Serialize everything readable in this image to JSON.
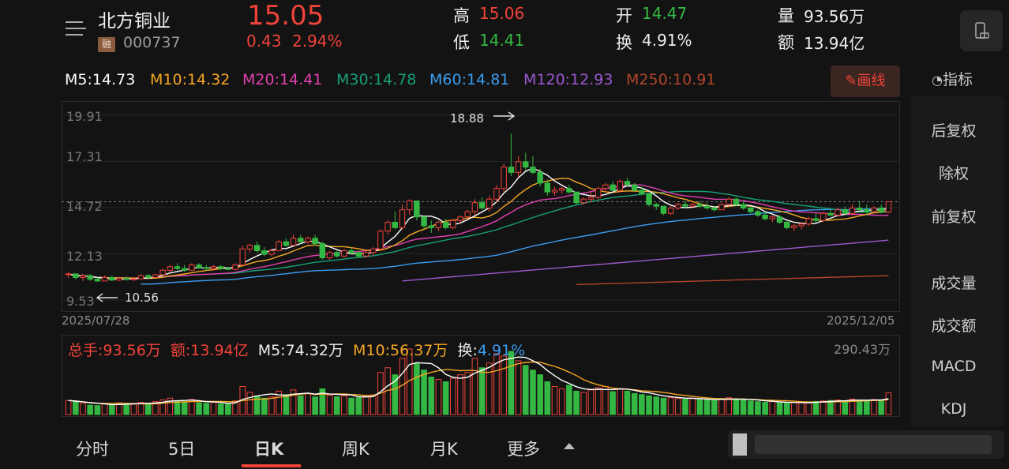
{
  "header": {
    "stock_name": "北方铜业",
    "margin_badge": "融",
    "stock_code": "000737",
    "last_price": "15.05",
    "change": "0.43",
    "change_pct": "2.94%",
    "high_label": "高",
    "high": "15.06",
    "low_label": "低",
    "low": "14.41",
    "open_label": "开",
    "open": "14.47",
    "turnover_label": "换",
    "turnover": "4.91%",
    "volume_label": "量",
    "volume": "93.56万",
    "amount_label": "额",
    "amount": "13.94亿"
  },
  "ma_legend": [
    {
      "label": "M5:14.73",
      "color": "#ffffff"
    },
    {
      "label": "M10:14.32",
      "color": "#f5a623"
    },
    {
      "label": "M20:14.41",
      "color": "#e040b0"
    },
    {
      "label": "M30:14.78",
      "color": "#17a07a"
    },
    {
      "label": "M60:14.81",
      "color": "#3b9df0"
    },
    {
      "label": "M120:12.93",
      "color": "#9b59d0"
    },
    {
      "label": "M250:10.91",
      "color": "#b0452a"
    }
  ],
  "toolbar": {
    "draw_line_label": "画线",
    "indicator_label": "指标"
  },
  "right_panel": {
    "items": [
      "后复权",
      "除权",
      "前复权",
      "成交量",
      "成交额",
      "MACD",
      "KDJ"
    ]
  },
  "chart": {
    "y_ticks": [
      "19.91",
      "17.31",
      "14.72",
      "12.13",
      "9.53"
    ],
    "start_date": "2025/07/28",
    "end_date": "2025/12/05",
    "high_marker": "18.88",
    "low_marker": "10.56"
  },
  "volume": {
    "total_label": "总手:93.56万",
    "amount_label": "额:13.94亿",
    "m5_label": "M5:74.32万",
    "m10_label": "M10:56.37万",
    "turnover_label_prefix": "换:",
    "turnover_value": "4.91%",
    "max_label": "290.43万"
  },
  "tabs": [
    "分时",
    "5日",
    "日K",
    "周K",
    "月K",
    "更多"
  ],
  "colors": {
    "up": "#f0433a",
    "down": "#35b843",
    "accent": "#f0433a",
    "background": "#131313"
  },
  "icons": [
    "menu-icon",
    "phone-landscape-icon",
    "pencil-icon",
    "gauge-icon",
    "arrow-right-icon",
    "arrow-left-icon",
    "caret-up-icon"
  ],
  "chart_data": {
    "type": "candlestick",
    "ylim": [
      9.53,
      19.91
    ],
    "y_ticks": [
      19.91,
      17.31,
      14.72,
      12.13,
      9.53
    ],
    "x_range": [
      "2025/07/28",
      "2025/12/05"
    ],
    "candles": [
      [
        11.0,
        11.1,
        10.8,
        11.0
      ],
      [
        11.0,
        11.0,
        10.7,
        10.8
      ],
      [
        10.8,
        11.0,
        10.6,
        10.9
      ],
      [
        10.9,
        11.0,
        10.6,
        10.7
      ],
      [
        10.7,
        10.8,
        10.56,
        10.6
      ],
      [
        10.6,
        10.9,
        10.6,
        10.8
      ],
      [
        10.8,
        10.9,
        10.6,
        10.65
      ],
      [
        10.65,
        10.8,
        10.6,
        10.75
      ],
      [
        10.75,
        10.85,
        10.6,
        10.7
      ],
      [
        10.7,
        10.8,
        10.6,
        10.72
      ],
      [
        10.72,
        11.0,
        10.7,
        10.9
      ],
      [
        10.9,
        11.0,
        10.7,
        10.8
      ],
      [
        10.8,
        11.0,
        10.8,
        10.95
      ],
      [
        10.95,
        11.3,
        10.9,
        11.2
      ],
      [
        11.2,
        11.5,
        11.1,
        11.4
      ],
      [
        11.4,
        11.6,
        11.2,
        11.3
      ],
      [
        11.3,
        11.5,
        11.1,
        11.2
      ],
      [
        11.2,
        11.6,
        11.2,
        11.5
      ],
      [
        11.5,
        11.6,
        11.3,
        11.35
      ],
      [
        11.35,
        11.5,
        11.2,
        11.3
      ],
      [
        11.3,
        11.5,
        11.2,
        11.4
      ],
      [
        11.4,
        11.5,
        11.2,
        11.3
      ],
      [
        11.3,
        11.4,
        11.2,
        11.25
      ],
      [
        11.25,
        11.6,
        11.2,
        11.5
      ],
      [
        11.5,
        12.6,
        11.5,
        12.4
      ],
      [
        12.4,
        12.7,
        12.2,
        12.6
      ],
      [
        12.6,
        12.8,
        12.2,
        12.3
      ],
      [
        12.3,
        12.5,
        12.0,
        12.1
      ],
      [
        12.1,
        12.4,
        12.0,
        12.3
      ],
      [
        12.3,
        12.9,
        12.3,
        12.8
      ],
      [
        12.8,
        13.0,
        12.5,
        12.6
      ],
      [
        12.6,
        13.2,
        12.6,
        13.0
      ],
      [
        13.0,
        13.2,
        12.7,
        12.8
      ],
      [
        12.8,
        13.1,
        12.7,
        13.0
      ],
      [
        13.0,
        13.2,
        12.6,
        12.7
      ],
      [
        12.7,
        12.8,
        11.8,
        11.9
      ],
      [
        11.9,
        12.3,
        11.8,
        12.2
      ],
      [
        12.2,
        12.3,
        11.9,
        12.0
      ],
      [
        12.0,
        12.4,
        11.9,
        12.3
      ],
      [
        12.3,
        12.5,
        12.1,
        12.2
      ],
      [
        12.2,
        12.3,
        11.9,
        12.0
      ],
      [
        12.0,
        12.3,
        11.9,
        12.2
      ],
      [
        12.2,
        12.5,
        12.0,
        12.4
      ],
      [
        12.4,
        13.5,
        12.4,
        13.4
      ],
      [
        13.4,
        14.0,
        13.2,
        13.9
      ],
      [
        13.9,
        14.5,
        13.5,
        13.6
      ],
      [
        13.6,
        14.9,
        13.5,
        14.6
      ],
      [
        14.6,
        15.2,
        14.3,
        15.1
      ],
      [
        15.1,
        15.1,
        14.0,
        14.2
      ],
      [
        14.2,
        14.3,
        13.5,
        13.7
      ],
      [
        13.7,
        14.0,
        13.3,
        13.6
      ],
      [
        13.6,
        14.0,
        13.4,
        13.9
      ],
      [
        13.9,
        14.1,
        13.5,
        13.6
      ],
      [
        13.6,
        14.1,
        13.5,
        14.0
      ],
      [
        14.0,
        14.3,
        13.8,
        14.2
      ],
      [
        14.2,
        14.6,
        14.1,
        14.5
      ],
      [
        14.5,
        15.2,
        14.3,
        15.0
      ],
      [
        15.0,
        15.3,
        14.6,
        14.7
      ],
      [
        14.7,
        15.4,
        14.5,
        15.2
      ],
      [
        15.2,
        16.0,
        15.0,
        15.8
      ],
      [
        15.8,
        17.2,
        15.6,
        17.0
      ],
      [
        17.0,
        18.88,
        16.5,
        16.7
      ],
      [
        16.7,
        17.6,
        16.4,
        17.3
      ],
      [
        17.3,
        17.8,
        16.8,
        17.0
      ],
      [
        17.0,
        17.6,
        16.6,
        16.7
      ],
      [
        16.7,
        16.9,
        15.9,
        16.1
      ],
      [
        16.1,
        16.3,
        15.4,
        15.6
      ],
      [
        15.6,
        15.9,
        15.4,
        15.7
      ],
      [
        15.7,
        15.9,
        15.5,
        15.8
      ],
      [
        15.8,
        16.0,
        15.5,
        15.6
      ],
      [
        15.6,
        15.6,
        14.9,
        15.0
      ],
      [
        15.0,
        15.3,
        14.9,
        15.2
      ],
      [
        15.2,
        15.6,
        15.0,
        15.3
      ],
      [
        15.3,
        15.9,
        15.2,
        15.8
      ],
      [
        15.8,
        16.1,
        15.6,
        16.0
      ],
      [
        16.0,
        16.2,
        15.6,
        15.7
      ],
      [
        15.7,
        16.3,
        15.6,
        16.2
      ],
      [
        16.2,
        16.4,
        15.9,
        16.0
      ],
      [
        16.0,
        16.1,
        15.6,
        15.7
      ],
      [
        15.7,
        15.9,
        15.4,
        15.5
      ],
      [
        15.5,
        15.5,
        14.8,
        14.9
      ],
      [
        14.9,
        15.0,
        14.6,
        14.8
      ],
      [
        14.8,
        14.8,
        14.3,
        14.4
      ],
      [
        14.4,
        14.8,
        14.3,
        14.7
      ],
      [
        14.7,
        15.0,
        14.6,
        14.9
      ],
      [
        14.9,
        15.1,
        14.7,
        14.8
      ],
      [
        14.8,
        15.0,
        14.7,
        14.9
      ],
      [
        14.9,
        15.1,
        14.7,
        14.8
      ],
      [
        14.8,
        15.0,
        14.6,
        14.7
      ],
      [
        14.7,
        14.8,
        14.5,
        14.6
      ],
      [
        14.6,
        15.0,
        14.6,
        14.9
      ],
      [
        14.9,
        15.3,
        14.8,
        15.2
      ],
      [
        15.2,
        15.3,
        14.8,
        14.9
      ],
      [
        14.9,
        15.1,
        14.6,
        14.7
      ],
      [
        14.7,
        14.8,
        14.4,
        14.5
      ],
      [
        14.5,
        14.6,
        14.2,
        14.3
      ],
      [
        14.3,
        14.5,
        14.0,
        14.1
      ],
      [
        14.1,
        14.3,
        13.9,
        14.2
      ],
      [
        14.2,
        14.3,
        13.8,
        13.9
      ],
      [
        13.9,
        14.0,
        13.5,
        13.6
      ],
      [
        13.6,
        13.8,
        13.4,
        13.7
      ],
      [
        13.7,
        13.9,
        13.5,
        13.8
      ],
      [
        13.8,
        14.2,
        13.7,
        14.1
      ],
      [
        14.1,
        14.4,
        13.9,
        14.0
      ],
      [
        14.0,
        14.5,
        13.9,
        14.4
      ],
      [
        14.4,
        14.6,
        14.2,
        14.3
      ],
      [
        14.3,
        14.7,
        14.2,
        14.6
      ],
      [
        14.6,
        14.8,
        14.3,
        14.4
      ],
      [
        14.4,
        14.9,
        14.3,
        14.7
      ],
      [
        14.7,
        15.1,
        14.5,
        14.6
      ],
      [
        14.6,
        14.9,
        14.3,
        14.5
      ],
      [
        14.5,
        14.8,
        14.4,
        14.7
      ],
      [
        14.7,
        14.9,
        14.4,
        14.5
      ],
      [
        14.47,
        15.06,
        14.41,
        15.05
      ]
    ],
    "volume": [
      60,
      55,
      48,
      40,
      38,
      45,
      42,
      50,
      46,
      44,
      52,
      48,
      55,
      62,
      70,
      58,
      55,
      64,
      50,
      48,
      52,
      46,
      44,
      58,
      120,
      95,
      80,
      70,
      75,
      100,
      85,
      105,
      80,
      90,
      75,
      110,
      82,
      76,
      80,
      70,
      72,
      78,
      84,
      180,
      200,
      170,
      240,
      280,
      220,
      190,
      160,
      150,
      140,
      155,
      170,
      180,
      240,
      200,
      220,
      260,
      250,
      270,
      230,
      210,
      190,
      170,
      140,
      120,
      110,
      125,
      100,
      95,
      105,
      115,
      120,
      98,
      110,
      100,
      90,
      85,
      80,
      75,
      70,
      72,
      68,
      66,
      70,
      64,
      62,
      60,
      68,
      72,
      65,
      62,
      58,
      55,
      52,
      56,
      50,
      48,
      52,
      50,
      54,
      56,
      58,
      60,
      62,
      58,
      66,
      62,
      60,
      64,
      58,
      93.56
    ],
    "ma_series": [
      {
        "name": "M5",
        "color": "#ffffff"
      },
      {
        "name": "M10",
        "color": "#f5a623"
      },
      {
        "name": "M20",
        "color": "#e040b0"
      },
      {
        "name": "M30",
        "color": "#17a07a"
      },
      {
        "name": "M60",
        "color": "#3b9df0"
      },
      {
        "name": "M120",
        "color": "#9b59d0"
      },
      {
        "name": "M250",
        "color": "#b0452a"
      }
    ]
  }
}
